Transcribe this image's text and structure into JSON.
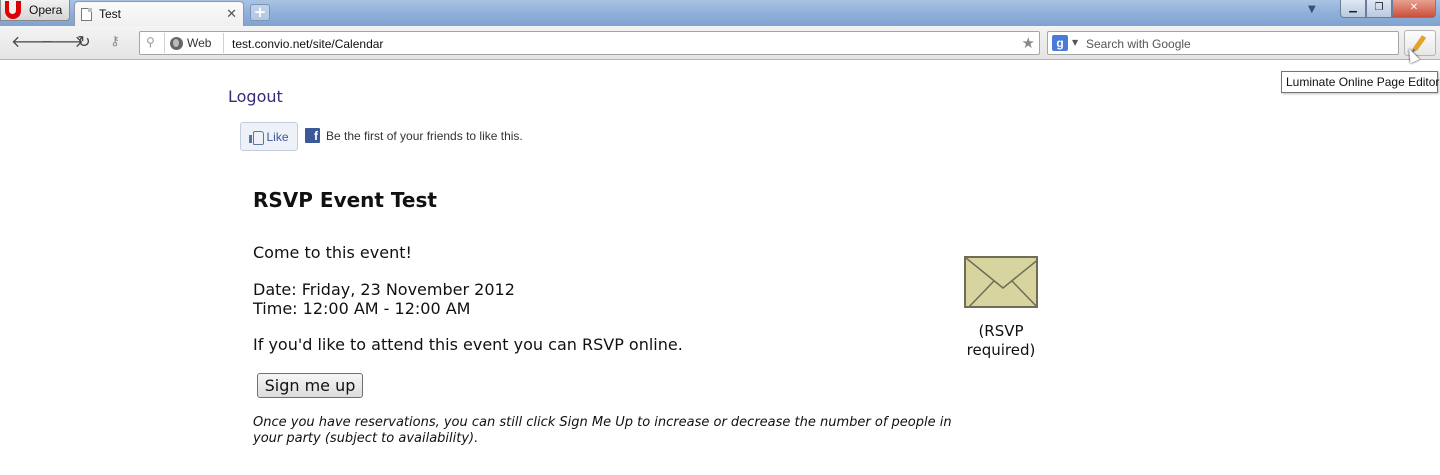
{
  "browser": {
    "menu_label": "Opera",
    "tab_title": "Test",
    "tab_close": "✕",
    "new_tab": "+",
    "address_badge": "Web",
    "url": "test.convio.net/site/Calendar",
    "search_placeholder": "Search with Google",
    "search_engine_letter": "g",
    "extension_tooltip": "Luminate Online Page Editor"
  },
  "page": {
    "logout_label": "Logout",
    "like_label": "Like",
    "facebook_letter": "f",
    "like_text": "Be the first of your friends to like this.",
    "event_title": "RSVP Event Test",
    "event_description": "Come to this event!",
    "date_line": "Date: Friday, 23 November 2012",
    "time_line": "Time: 12:00 AM - 12:00 AM",
    "rsvp_text": "If you'd like to attend this event you can RSVP online.",
    "signup_label": "Sign me up",
    "note": "Once you have reservations, you can still click Sign Me Up to increase or decrease the number of people in your party (subject to availability).",
    "rsvp_required": "(RSVP required)"
  },
  "colors": {
    "link": "#3a2a78",
    "facebook_blue": "#3b5998",
    "envelope_fill": "#d8d4a0",
    "titlebar": "#8fb0da",
    "close_button": "#c9503a"
  },
  "icons": [
    "opera-logo-icon",
    "page-icon",
    "back-arrow-icon",
    "forward-arrow-icon",
    "reload-icon",
    "key-icon",
    "location-pin-icon",
    "globe-icon",
    "star-icon",
    "google-icon",
    "pencil-icon",
    "cursor-icon",
    "thumbs-up-icon",
    "facebook-icon",
    "envelope-icon"
  ]
}
